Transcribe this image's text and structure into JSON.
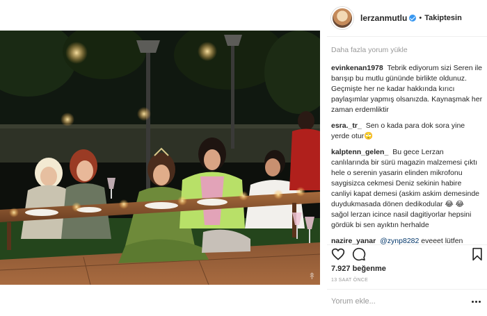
{
  "post": {
    "author": {
      "username": "lerzanmutlu",
      "verified": true,
      "follow_status": "Takiptesin",
      "separator": "•"
    },
    "load_more_label": "Daha fazla yorum yükle",
    "comments": [
      {
        "user": "evinkenan1978",
        "text": "Tebrik ediyorum sizi Seren ile barışıp bu mutlu gününde birlikte oldunuz. Geçmişte her ne kadar hakkında kırıcı paylaşımlar yapmış olsanızda. Kaynaşmak her zaman erdemliktir"
      },
      {
        "user": "esra._tr_",
        "text": "Sen o kada para dok sora yine yerde otur🙄"
      },
      {
        "user": "kalptenn_gelen_",
        "text": "Bu gece Lerzan canlılarında bir sürü magazin malzemesi çıktı hele o serenin yasarin elinden mikrofonu saygisizca cekmesi Deniz sekinin habire canliyi kapat demesi (askim askim demesinde duydukmasada dönen dedikodular 😂 😂 sağol lerzan icince nasil dagitiyorlar hepsini gördük bi sen ayıktın herhalde"
      },
      {
        "user": "nazire_yanar",
        "mention": "@zynp8282",
        "text": "eveeet lütfen barışsınlar"
      }
    ],
    "likes_label": "7.927 beğenme",
    "time_label": "13 SAAT ÖNCE",
    "add_comment_placeholder": "Yorum ekle...",
    "icons": [
      "heart-icon",
      "comment-icon",
      "bookmark-icon",
      "more-options-icon"
    ],
    "watermark_text": "↟"
  },
  "colors": {
    "text": "#262626",
    "muted": "#999999",
    "verified": "#3897f0",
    "mention": "#003569",
    "photo_dark": "#0d100c",
    "dress_green": "#b8e068"
  }
}
